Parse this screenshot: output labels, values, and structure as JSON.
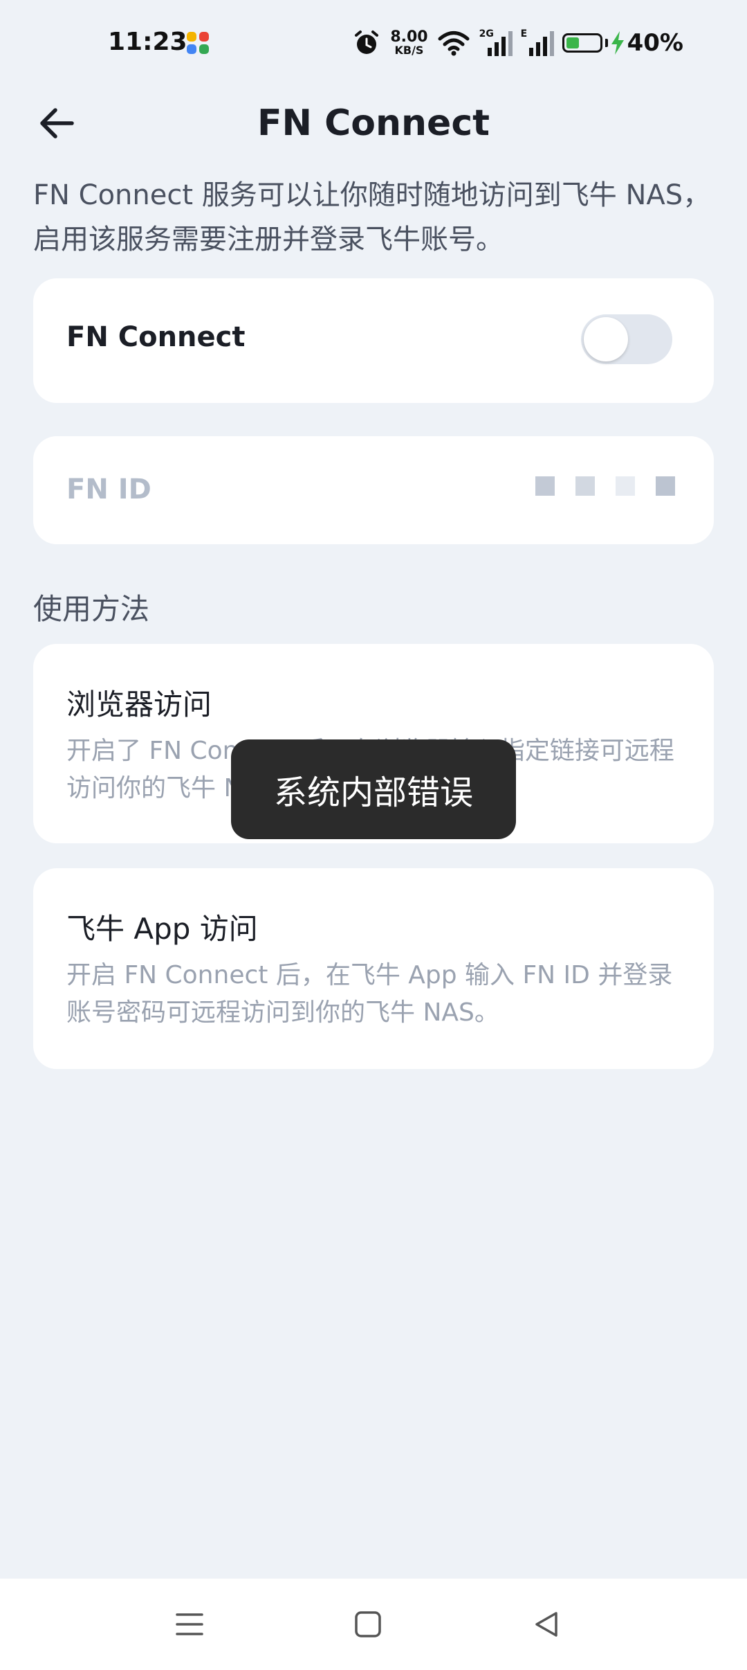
{
  "status_bar": {
    "time": "11:23",
    "speed_value": "8.00",
    "speed_unit": "KB/S",
    "signal_1_label": "2G",
    "signal_2_label": "E",
    "battery": "40%",
    "battery_level": 0.4
  },
  "header": {
    "title": "FN Connect"
  },
  "intro": "FN Connect 服务可以让你随时随地访问到飞牛 NAS，启用该服务需要注册并登录飞牛账号。",
  "connect_card": {
    "label": "FN Connect",
    "enabled": false
  },
  "fnid_card": {
    "label": "FN ID"
  },
  "usage": {
    "title": "使用方法",
    "items": [
      {
        "title": "浏览器访问",
        "description": "开启了 FN Connect 后，在浏览器输入指定链接可远程访问你的飞牛 NAS。"
      },
      {
        "title": "飞牛 App 访问",
        "description": "开启 FN Connect 后，在飞牛 App 输入 FN ID 并登录账号密码可远程访问到你的飞牛 NAS。"
      }
    ]
  },
  "toast": {
    "message": "系统内部错误"
  },
  "colors": {
    "background": "#eef2f7",
    "card": "#ffffff",
    "toast": "#2b2b2b",
    "battery": "#3ab54a"
  }
}
